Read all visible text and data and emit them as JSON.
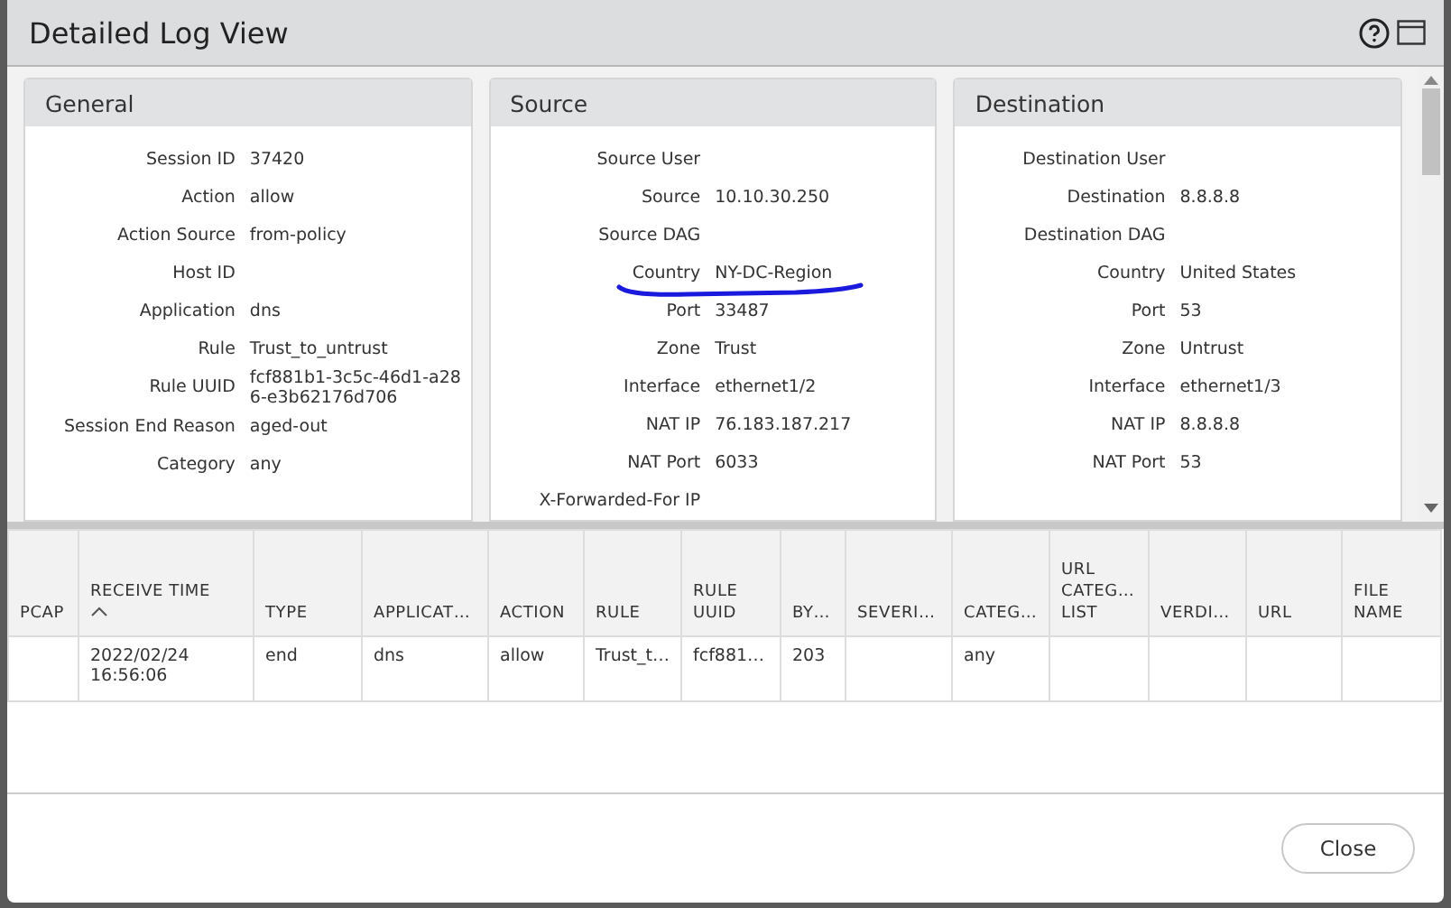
{
  "window": {
    "title": "Detailed Log View"
  },
  "panels": [
    {
      "title": "General",
      "fields": [
        {
          "label": "Session ID",
          "value": "37420"
        },
        {
          "label": "Action",
          "value": "allow"
        },
        {
          "label": "Action Source",
          "value": "from-policy"
        },
        {
          "label": "Host ID"
        },
        {
          "label": "Application",
          "value": "dns"
        },
        {
          "label": "Rule",
          "value": "Trust_to_untrust"
        },
        {
          "label": "Rule UUID",
          "value": "fcf881b1-3c5c-46d1-a286-e3b62176d706"
        },
        {
          "label": "Session End Reason",
          "value": "aged-out"
        },
        {
          "label": "Category",
          "value": "any"
        }
      ]
    },
    {
      "title": "Source",
      "fields": [
        {
          "label": "Source User"
        },
        {
          "label": "Source",
          "value": "10.10.30.250"
        },
        {
          "label": "Source DAG"
        },
        {
          "label": "Country",
          "value": "NY-DC-Region",
          "underlined": true
        },
        {
          "label": "Port",
          "value": "33487"
        },
        {
          "label": "Zone",
          "value": "Trust"
        },
        {
          "label": "Interface",
          "value": "ethernet1/2"
        },
        {
          "label": "NAT IP",
          "value": "76.183.187.217"
        },
        {
          "label": "NAT Port",
          "value": "6033"
        },
        {
          "label": "X-Forwarded-For IP"
        }
      ]
    },
    {
      "title": "Destination",
      "fields": [
        {
          "label": "Destination User"
        },
        {
          "label": "Destination",
          "value": "8.8.8.8"
        },
        {
          "label": "Destination DAG"
        },
        {
          "label": "Country",
          "value": "United States"
        },
        {
          "label": "Port",
          "value": "53"
        },
        {
          "label": "Zone",
          "value": "Untrust"
        },
        {
          "label": "Interface",
          "value": "ethernet1/3"
        },
        {
          "label": "NAT IP",
          "value": "8.8.8.8"
        },
        {
          "label": "NAT Port",
          "value": "53"
        }
      ]
    }
  ],
  "table": {
    "columns": [
      {
        "label": "PCAP"
      },
      {
        "label": "RECEIVE TIME",
        "sorted": true
      },
      {
        "label": "TYPE"
      },
      {
        "label": "APPLICAT…"
      },
      {
        "label": "ACTION"
      },
      {
        "label": "RULE"
      },
      {
        "label": "RULE UUID"
      },
      {
        "label": "BY…"
      },
      {
        "label": "SEVERI…"
      },
      {
        "label": "CATEG…"
      },
      {
        "label": "URL CATEG… LIST"
      },
      {
        "label": "VERDI…"
      },
      {
        "label": "URL"
      },
      {
        "label": "FILE NAME"
      }
    ],
    "rows": [
      [
        null,
        "2022/02/24 16:56:06",
        "end",
        "dns",
        "allow",
        "Trust_t…",
        "fcf881…",
        "203",
        null,
        "any",
        null,
        null,
        null,
        null
      ]
    ]
  },
  "buttons": [
    "Close"
  ]
}
